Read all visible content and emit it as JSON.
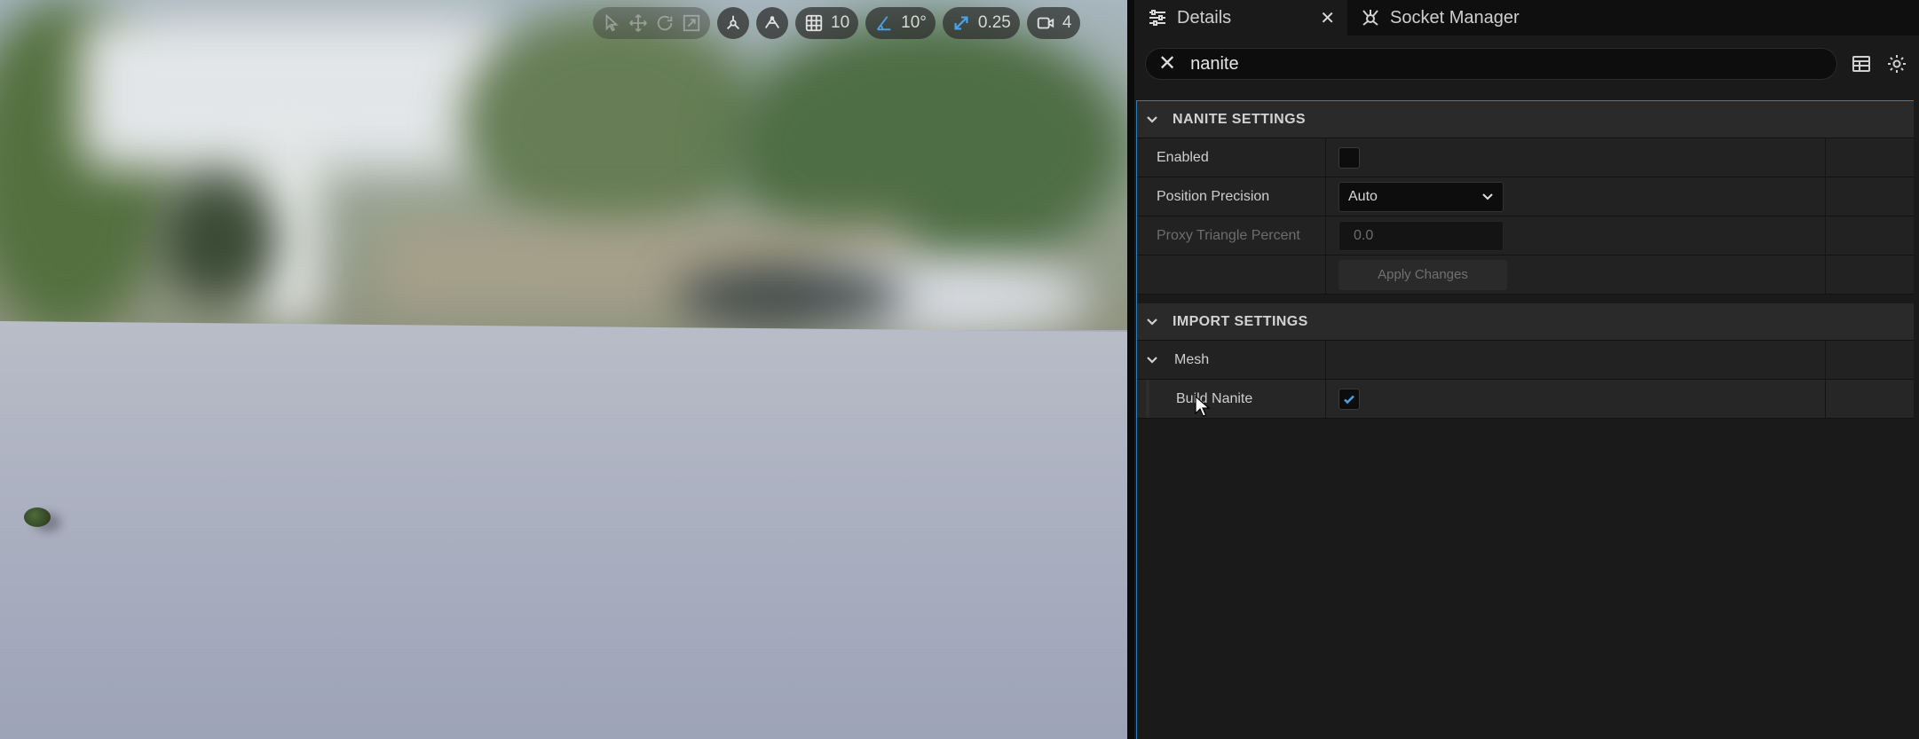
{
  "viewport": {
    "toolbar": {
      "grid_snap_value": "10",
      "rotation_snap_value": "10°",
      "scale_snap_value": "0.25",
      "camera_speed_value": "4"
    }
  },
  "panel": {
    "tabs": [
      {
        "label": "Details",
        "icon": "sliders-icon",
        "active": true
      },
      {
        "label": "Socket Manager",
        "icon": "socket-icon",
        "active": false
      }
    ],
    "search": {
      "value": "nanite"
    },
    "sections": {
      "nanite": {
        "title": "NANITE SETTINGS",
        "enabled_label": "Enabled",
        "enabled_checked": false,
        "position_precision_label": "Position Precision",
        "position_precision_value": "Auto",
        "proxy_triangle_label": "Proxy Triangle Percent",
        "proxy_triangle_value": "0.0",
        "apply_label": "Apply Changes"
      },
      "import": {
        "title": "IMPORT SETTINGS",
        "mesh_label": "Mesh",
        "build_nanite_label": "Build Nanite",
        "build_nanite_checked": true
      }
    },
    "colors": {
      "accent": "#2e7fbf",
      "check": "#4aa3e8"
    }
  }
}
